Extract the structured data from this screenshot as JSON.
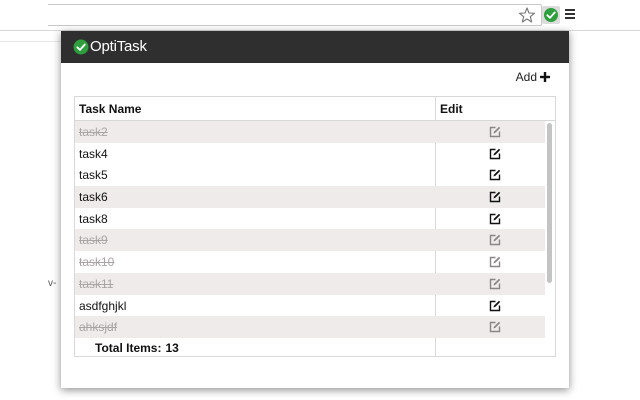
{
  "app": {
    "title": "OptiTask"
  },
  "toolbar": {
    "add_label": "Add"
  },
  "table": {
    "headers": [
      "Task Name",
      "Edit"
    ],
    "rows": [
      {
        "name": "task2",
        "completed": true
      },
      {
        "name": "task4",
        "completed": false
      },
      {
        "name": "task5",
        "completed": false
      },
      {
        "name": "task6",
        "completed": false
      },
      {
        "name": "task8",
        "completed": false
      },
      {
        "name": "task9",
        "completed": true
      },
      {
        "name": "task10",
        "completed": true
      },
      {
        "name": "task11",
        "completed": true
      },
      {
        "name": "asdfghjkl",
        "completed": false
      },
      {
        "name": "ahksjdf",
        "completed": true
      }
    ]
  },
  "footer": {
    "total_label": "Total Items:",
    "total_count": "13"
  },
  "background": {
    "partial_text": "v-"
  },
  "icons": {
    "star": "star-icon",
    "extension": "checkmark-circle-icon",
    "menu": "hamburger-menu-icon",
    "add": "plus-icon",
    "edit": "edit-icon"
  },
  "colors": {
    "header_bg": "#2f2f2f",
    "accent_green": "#2e9e3e",
    "row_shade": "#efebea",
    "completed_text": "#a9a5a5"
  }
}
